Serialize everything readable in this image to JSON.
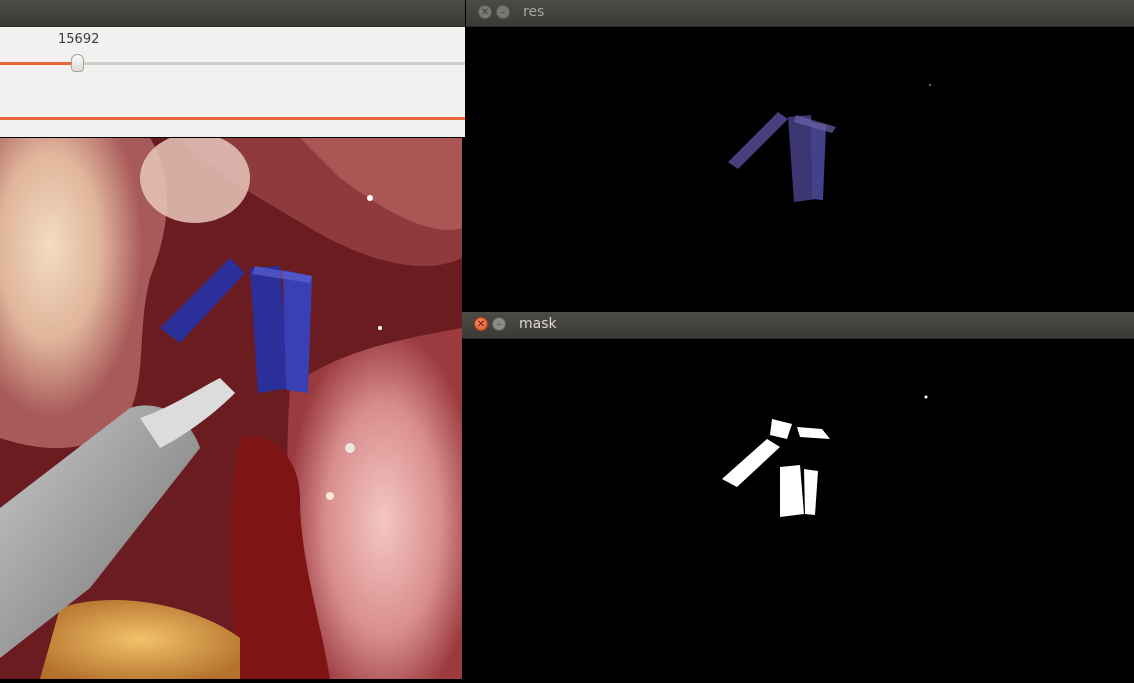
{
  "trackbar": {
    "value": "15692",
    "position_fraction": 0.17
  },
  "windows": {
    "res": {
      "title": "res"
    },
    "mask": {
      "title": "mask"
    }
  },
  "colors": {
    "accent_orange": "#e8683b",
    "titlebar": "#3b3a36",
    "panel_bg": "#f2f1f0",
    "clip_blue": "#2b2f9a",
    "res_purple": "#4a3f7e"
  },
  "icons": [
    "close-icon",
    "minimize-icon"
  ]
}
